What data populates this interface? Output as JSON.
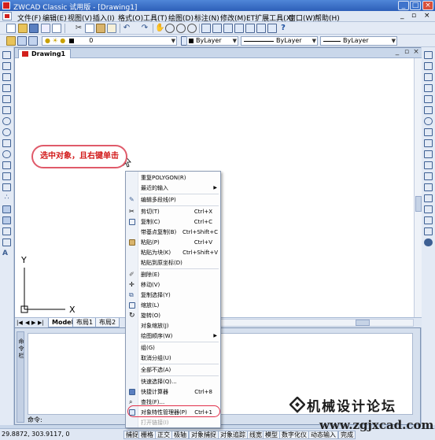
{
  "window": {
    "title": "ZWCAD Classic 试用版 - [Drawing1]",
    "min_label": "_",
    "max_label": "□",
    "close_label": "×"
  },
  "menubar": {
    "items": [
      "文件(F)",
      "编辑(E)",
      "视图(V)",
      "插入(I)",
      "格式(O)",
      "工具(T)",
      "绘图(D)",
      "标注(N)",
      "修改(M)",
      "ET扩展工具(X)",
      "窗口(W)",
      "帮助(H)"
    ],
    "doc_min": "_",
    "doc_restore": "▫",
    "doc_close": "×"
  },
  "toolbar2": {
    "layer_value": "0",
    "color_value": "ByLayer",
    "linetype_value": "ByLayer",
    "lineweight_value": "ByLayer"
  },
  "document": {
    "tab_label": "Drawing1",
    "ucs_x": "X",
    "ucs_y": "Y",
    "layout_tabs": [
      "Model",
      "布局1",
      "布局2"
    ],
    "nav_first": "|◀",
    "nav_prev": "◀",
    "nav_next": "▶",
    "nav_last": "▶|"
  },
  "callout": {
    "text": "选中对象，且右键单击"
  },
  "command": {
    "grip_label": "命令栏",
    "prompt": "命令:"
  },
  "context_menu": {
    "items": [
      {
        "label": "重复POLYGON(R)",
        "shortcut": "",
        "submenu": false,
        "disabled": false
      },
      {
        "label": "最近的输入",
        "shortcut": "",
        "submenu": true,
        "disabled": false
      },
      {
        "label": "编辑多段线(P)",
        "shortcut": "",
        "submenu": false,
        "disabled": false
      },
      {
        "label": "剪切(T)",
        "shortcut": "Ctrl+X",
        "submenu": false,
        "disabled": false
      },
      {
        "label": "复制(C)",
        "shortcut": "Ctrl+C",
        "submenu": false,
        "disabled": false
      },
      {
        "label": "带基点复制(B)",
        "shortcut": "Ctrl+Shift+C",
        "submenu": false,
        "disabled": false
      },
      {
        "label": "粘贴(P)",
        "shortcut": "Ctrl+V",
        "submenu": false,
        "disabled": false
      },
      {
        "label": "粘贴为块(K)",
        "shortcut": "Ctrl+Shift+V",
        "submenu": false,
        "disabled": false
      },
      {
        "label": "粘贴到原坐标(D)",
        "shortcut": "",
        "submenu": false,
        "disabled": false
      },
      {
        "label": "删除(E)",
        "shortcut": "",
        "submenu": false,
        "disabled": false
      },
      {
        "label": "移动(V)",
        "shortcut": "",
        "submenu": false,
        "disabled": false
      },
      {
        "label": "复制选择(Y)",
        "shortcut": "",
        "submenu": false,
        "disabled": false
      },
      {
        "label": "缩放(L)",
        "shortcut": "",
        "submenu": false,
        "disabled": false
      },
      {
        "label": "旋转(O)",
        "shortcut": "",
        "submenu": false,
        "disabled": false
      },
      {
        "label": "对象缩放(J)",
        "shortcut": "",
        "submenu": false,
        "disabled": false
      },
      {
        "label": "绘图顺序(W)",
        "shortcut": "",
        "submenu": true,
        "disabled": false
      },
      {
        "label": "组(G)",
        "shortcut": "",
        "submenu": false,
        "disabled": false
      },
      {
        "label": "取消分组(U)",
        "shortcut": "",
        "submenu": false,
        "disabled": false
      },
      {
        "label": "全部不选(A)",
        "shortcut": "",
        "submenu": false,
        "disabled": false
      },
      {
        "label": "快速选择(Q)...",
        "shortcut": "",
        "submenu": false,
        "disabled": false
      },
      {
        "label": "快捷计算器",
        "shortcut": "Ctrl+8",
        "submenu": false,
        "disabled": false
      },
      {
        "label": "查找(F)...",
        "shortcut": "",
        "submenu": false,
        "disabled": false
      },
      {
        "label": "对象特性管理器(P)",
        "shortcut": "Ctrl+1",
        "submenu": false,
        "disabled": false
      },
      {
        "label": "打开链接(I)",
        "shortcut": "",
        "submenu": false,
        "disabled": true
      }
    ]
  },
  "statusbar": {
    "coords": "29.8872,  303.9117,  0",
    "buttons": [
      "捕捉",
      "栅格",
      "正交",
      "极轴",
      "对象捕捉",
      "对象追踪",
      "线宽",
      "模型",
      "数字化仪",
      "动态输入",
      "完成"
    ]
  },
  "watermark": {
    "title": "机械设计论坛",
    "url": "www.zgjxcad.com"
  },
  "colors": {
    "titlebar": "#2d5fb8",
    "accent_red": "#e0304a",
    "callout_text": "#d21a1a"
  }
}
